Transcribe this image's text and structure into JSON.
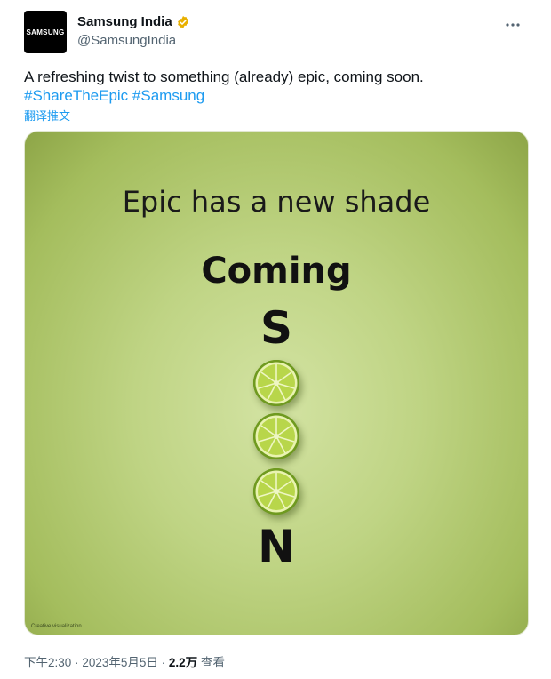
{
  "author": {
    "avatar_text": "SAMSUNG",
    "display_name": "Samsung India",
    "handle": "@SamsungIndia",
    "verified_color": "#e8b000"
  },
  "tweet": {
    "text": "A refreshing twist to something (already) epic, coming soon.",
    "hashtags": [
      "#ShareTheEpic",
      "#Samsung"
    ],
    "translate_label": "翻译推文"
  },
  "media": {
    "headline": "Epic has a new shade",
    "coming": "Coming",
    "letter_s": "S",
    "letter_n": "N",
    "caption": "Creative visualization."
  },
  "meta": {
    "time": "下午2:30",
    "date": "2023年5月5日",
    "separator": "·",
    "views_count": "2.2万",
    "views_label": "查看"
  },
  "colors": {
    "link": "#1d9bf0",
    "muted": "#536471"
  }
}
